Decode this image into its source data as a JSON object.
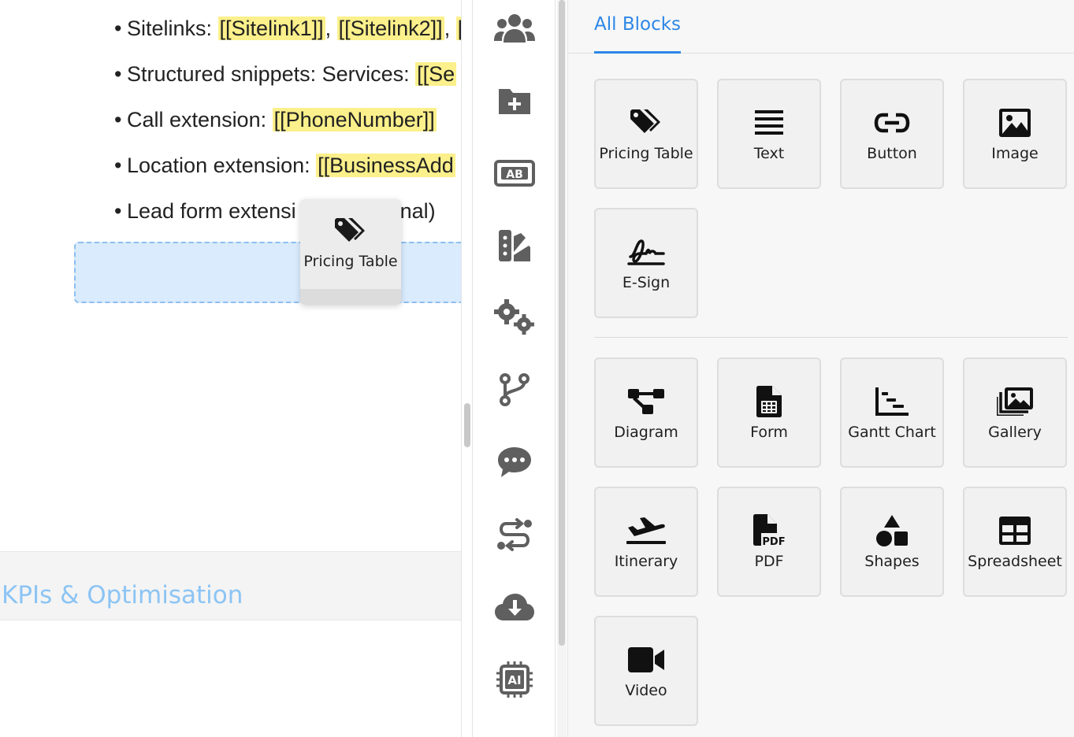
{
  "document": {
    "bullets": [
      {
        "prefix": "Sitelinks: ",
        "parts": [
          {
            "text": "[[Sitelink1]]",
            "highlight": true
          },
          {
            "text": ", ",
            "highlight": false
          },
          {
            "text": "[[Sitelink2]]",
            "highlight": true
          },
          {
            "text": ", ",
            "highlight": false
          },
          {
            "text": "[[",
            "highlight": true
          }
        ]
      },
      {
        "prefix": "Structured snippets: Services: ",
        "parts": [
          {
            "text": "[[Se",
            "highlight": true
          }
        ]
      },
      {
        "prefix": "Call extension: ",
        "parts": [
          {
            "text": "[[PhoneNumber]]",
            "highlight": true
          }
        ]
      },
      {
        "prefix": "Location extension: ",
        "parts": [
          {
            "text": "[[BusinessAdd",
            "highlight": true
          }
        ]
      },
      {
        "prefix": "Lead form extensi",
        "parts": [
          {
            "text": "",
            "highlight": false
          }
        ],
        "suffix": "nal)"
      }
    ],
    "drag_preview_label": "Pricing Table",
    "section_title": "KPIs & Optimisation"
  },
  "rail": {
    "icons": [
      "users-icon",
      "add-folder-icon",
      "variables-icon",
      "styles-icon",
      "settings-icon",
      "branch-icon",
      "comments-icon",
      "automation-icon",
      "cloud-download-icon",
      "ai-chip-icon"
    ]
  },
  "panel": {
    "tab_label": "All Blocks",
    "basic_blocks": [
      {
        "label": "Pricing Table",
        "icon": "tags-icon"
      },
      {
        "label": "Text",
        "icon": "text-lines-icon"
      },
      {
        "label": "Button",
        "icon": "link-icon"
      },
      {
        "label": "Image",
        "icon": "image-icon"
      },
      {
        "label": "E-Sign",
        "icon": "signature-icon"
      }
    ],
    "advanced_blocks": [
      {
        "label": "Diagram",
        "icon": "diagram-icon"
      },
      {
        "label": "Form",
        "icon": "form-icon"
      },
      {
        "label": "Gantt Chart",
        "icon": "gantt-icon"
      },
      {
        "label": "Gallery",
        "icon": "gallery-icon"
      },
      {
        "label": "Itinerary",
        "icon": "plane-icon"
      },
      {
        "label": "PDF",
        "icon": "pdf-icon"
      },
      {
        "label": "Shapes",
        "icon": "shapes-icon"
      },
      {
        "label": "Spreadsheet",
        "icon": "spreadsheet-icon"
      },
      {
        "label": "Video",
        "icon": "video-icon"
      }
    ]
  },
  "colors": {
    "accent": "#2d87e6",
    "highlight": "#fbf08b",
    "drop_zone": "#d9ebfd",
    "section_title": "#8cc4f4",
    "icon_gray": "#5f5f5f"
  }
}
